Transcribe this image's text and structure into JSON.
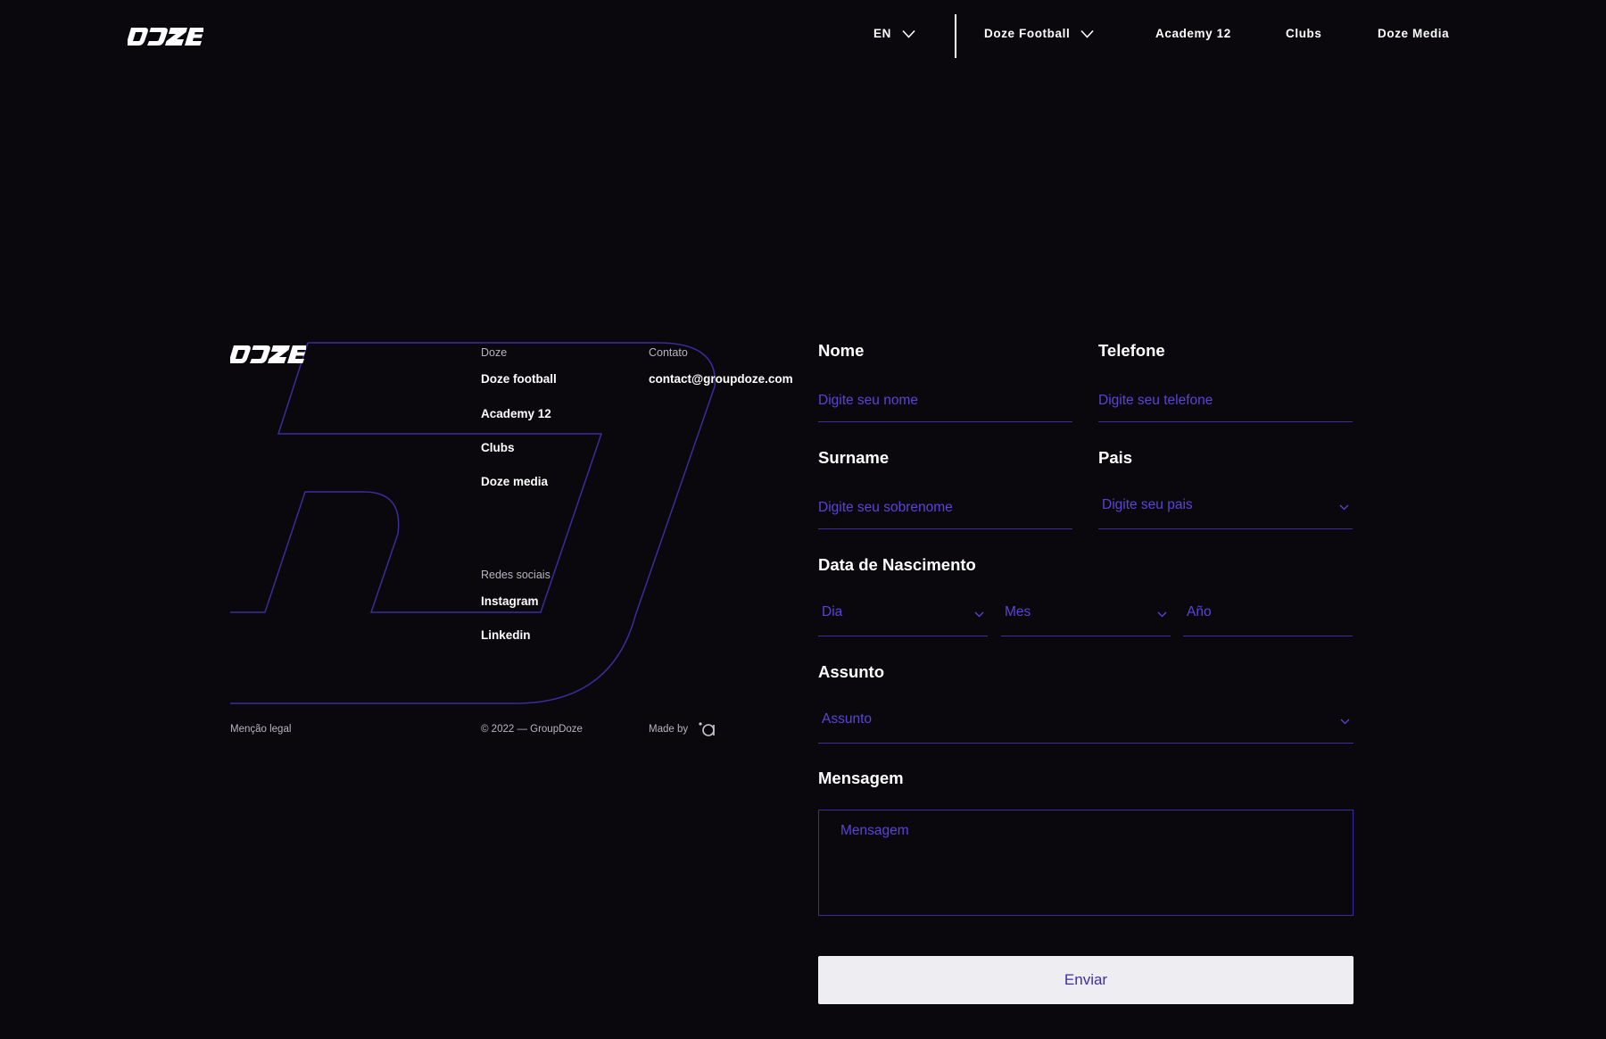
{
  "header": {
    "language": "EN",
    "nav": {
      "doze_football": "Doze Football",
      "academy": "Academy 12",
      "clubs": "Clubs",
      "media": "Doze Media"
    }
  },
  "footer": {
    "doze_heading": "Doze",
    "links": {
      "doze_football": "Doze football",
      "academy": "Academy 12",
      "clubs": "Clubs",
      "media": "Doze media"
    },
    "contact_heading": "Contato",
    "contact_email": "contact@groupdoze.com",
    "social_heading": "Redes sociais",
    "social": {
      "instagram": "Instagram",
      "linkedin": "Linkedin"
    },
    "legal": "Menção legal",
    "copyright": "© 2022 — GroupDoze",
    "made_by": "Made by"
  },
  "form": {
    "nome": {
      "label": "Nome",
      "placeholder": "Digite seu nome"
    },
    "telefone": {
      "label": "Telefone",
      "placeholder": "Digite seu telefone"
    },
    "surname": {
      "label": "Surname",
      "placeholder": "Digite seu sobrenome"
    },
    "pais": {
      "label": "Pais",
      "placeholder": "Digite seu pais"
    },
    "nascimento": {
      "label": "Data de Nascimento",
      "dia": "Dia",
      "mes": "Mes",
      "ano": "Año"
    },
    "assunto": {
      "label": "Assunto",
      "placeholder": "Assunto"
    },
    "mensagem": {
      "label": "Mensagem",
      "placeholder": "Mensagem"
    },
    "submit_label": "Enviar"
  },
  "colors": {
    "background": "#0a080d",
    "accent": "#3a2d9c",
    "placeholder": "#5a44d9",
    "button_bg": "#eeedf2",
    "button_text": "#3d2fa8"
  }
}
